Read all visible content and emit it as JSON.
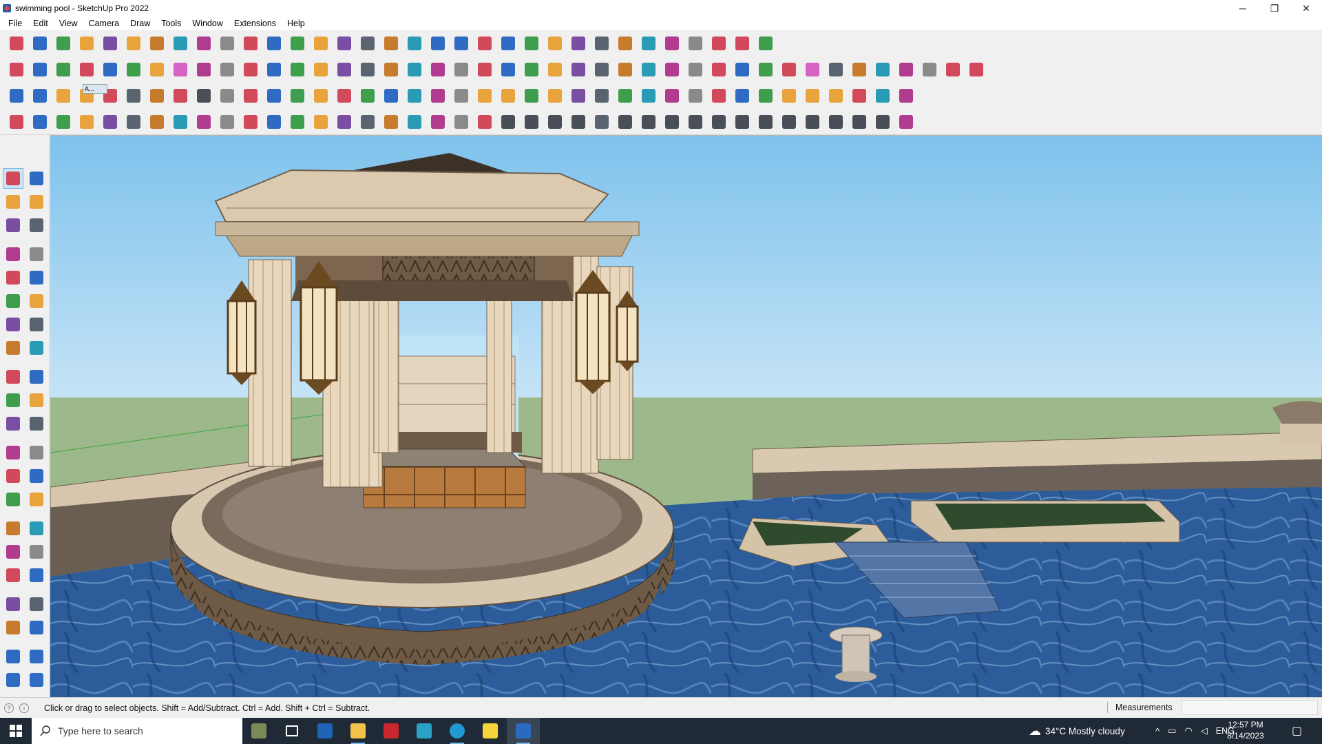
{
  "window": {
    "title": "swimming pool - SketchUp Pro 2022",
    "controls": {
      "minimize": "─",
      "restore": "❐",
      "close": "✕"
    }
  },
  "menu": [
    "File",
    "Edit",
    "View",
    "Camera",
    "Draw",
    "Tools",
    "Window",
    "Extensions",
    "Help"
  ],
  "toolbars": {
    "row1_icons": [
      "zoom-search-icon",
      "select-arrow-icon",
      "eraser-icon",
      "pencil-icon",
      "lasso-icon",
      "paint-icon",
      "push-pull-icon",
      "follow-me-icon",
      "move-icon",
      "rotate-icon",
      "scale-icon",
      "tape-measure-icon",
      "text-icon",
      "paint-bucket-icon",
      "orbit-icon",
      "pan-icon",
      "zoom-icon",
      "zoom-extents-icon",
      "section-plane-icon",
      "section-cut-icon",
      "x-ray-icon",
      "account-icon",
      "components-icon",
      "materials-icon",
      "styles-icon",
      "sandbox-icon",
      "up-arrow-icon",
      "down-arrow-icon",
      "tools-icon",
      "export-icon",
      "undo-icon",
      "redo-icon",
      "warehouse-icon"
    ],
    "row2_icons": [
      "box-shaded-icon",
      "box-xray-icon",
      "box-wire-icon",
      "plugin-red-icon",
      "plugin-blue-icon",
      "plugin-green-icon",
      "plugin-orange-icon",
      "plugin-pink-icon",
      "curve-icon",
      "parallel-view-icon",
      "perspective-icon",
      "two-point-icon",
      "iso-view-icon",
      "top-view-icon",
      "front-view-icon",
      "right-view-icon",
      "back-view-icon",
      "left-view-icon",
      "house-icon",
      "house-outline-icon",
      "house-alt-icon",
      "function-icon",
      "tag-icon",
      "eyedropper-icon",
      "shape-rect-icon",
      "shape-circle-icon",
      "shape-poly-icon",
      "shape-ellipse-icon",
      "shape-para-icon",
      "shape-arc-icon",
      "shape-torus-icon",
      "shape-ring-icon",
      "shape-star-icon",
      "measure-red-icon",
      "eraser-pink-icon",
      "texture-icon",
      "grid-icon",
      "terrain-icon",
      "shell-icon",
      "cloth-icon",
      "image-icon",
      "paint-red-icon"
    ],
    "row3_icons": [
      "face-blue-icon",
      "face-cyan-icon",
      "face-yellow-icon",
      "active-ext-icon",
      "face-red-icon",
      "stack-icon",
      "bend-icon",
      "square-red-icon",
      "grid-lines-icon",
      "roof-icon",
      "wood-icon",
      "tube-icon",
      "arch-icon",
      "curve-pts-icon",
      "cross-red-icon",
      "cross-green-icon",
      "cross-blue-icon",
      "cone-icon",
      "bell-icon",
      "warning-icon",
      "ring-gold-icon",
      "ring-orange-icon",
      "ring-dots-icon",
      "arrows-icon",
      "bucket-icon",
      "hook-icon",
      "pattern-green-icon",
      "split-icon",
      "cube-split-icon",
      "explode-icon",
      "gift-icon",
      "bolts-icon",
      "frame-icon",
      "tile-gold-icon",
      "tile-gold2-icon",
      "tile-gold3-icon",
      "dots-red-icon",
      "circle-dotted-icon",
      "arrange-icon"
    ],
    "row4_icons": [
      "wall-icon",
      "spline-icon",
      "fill-icon",
      "active-plugin-icon",
      "spring-icon",
      "shell2-icon",
      "twist-icon",
      "shape-mesh-icon",
      "sphere-icon",
      "flip-icon",
      "rail-icon",
      "rail2-icon",
      "stairs-icon",
      "pipe-icon",
      "fence-icon",
      "ramp-icon",
      "columns-icon",
      "hand-icon",
      "leaf-icon",
      "blade-icon",
      "layers-icon",
      "lines-icon",
      "lines2-icon",
      "lines3-icon",
      "lines4-icon",
      "bench-icon",
      "stripes-icon",
      "stripes2-icon",
      "stripes3-icon",
      "stripes4-icon",
      "hatch-icon",
      "hatch2-icon",
      "hatch3-icon",
      "bars-icon",
      "gear-dark-icon",
      "gear-dark2-icon",
      "stripes5-icon",
      "stripes6-icon",
      "house3d-icon"
    ],
    "active_toolbar_label": "A..."
  },
  "left_palette_icons": [
    [
      "select-tool-icon",
      "orbit-tool-icon"
    ],
    [
      "paint-bucket-tool-icon",
      "eraser-tool-icon"
    ],
    [
      "components-tool-icon",
      "tape-tool-icon"
    ],
    [],
    [
      "line-tool-icon",
      "freehand-tool-icon"
    ],
    [
      "rectangle-tool-icon",
      "rotated-rect-tool-icon"
    ],
    [
      "circle-tool-icon",
      "polygon-tool-icon"
    ],
    [
      "arc-tool-icon",
      "arc-2pt-tool-icon"
    ],
    [
      "arc-3pt-tool-icon",
      "pie-tool-icon"
    ],
    [],
    [
      "move-tool-icon",
      "push-pull-tool-icon"
    ],
    [
      "rotate-tool-icon",
      "follow-me-tool-icon"
    ],
    [
      "scale-tool-icon",
      "offset-tool-icon"
    ],
    [],
    [
      "tape-measure-tool-icon",
      "dimension-tool-icon"
    ],
    [
      "protractor-tool-icon",
      "text-tool-icon"
    ],
    [
      "axes-tool-icon",
      "3d-text-tool-icon"
    ],
    [],
    [
      "orbit2-tool-icon",
      "pan-tool-icon"
    ],
    [
      "zoom-tool-icon",
      "zoom-window-tool-icon"
    ],
    [
      "zoom-extents-tool-icon",
      "previous-view-tool-icon"
    ],
    [],
    [
      "position-camera-tool-icon",
      "look-around-tool-icon"
    ],
    [
      "walk-tool-icon",
      "section-plane-tool-icon"
    ],
    [],
    [
      "section-display-tool-icon",
      "section-cuts-tool-icon"
    ],
    [
      "section-fill-tool-icon",
      "section-lines-tool-icon"
    ]
  ],
  "statusbar": {
    "hint": "Click or drag to select objects. Shift = Add/Subtract. Ctrl = Add. Shift + Ctrl = Subtract.",
    "measurements_label": "Measurements",
    "measurements_value": ""
  },
  "taskbar": {
    "search_placeholder": "Type here to search",
    "weather": "34°C  Mostly cloudy",
    "language": "ENG",
    "time": "12:57 PM",
    "date": "8/14/2023"
  },
  "colors": {
    "sky_top": "#7ec2ec",
    "sky_bottom": "#dbeefa",
    "ground": "#9db88a",
    "stone": "#e2cfb5",
    "pool": "#2c5d9a",
    "wood": "#b87a3e",
    "taskbar": "#202a36"
  }
}
